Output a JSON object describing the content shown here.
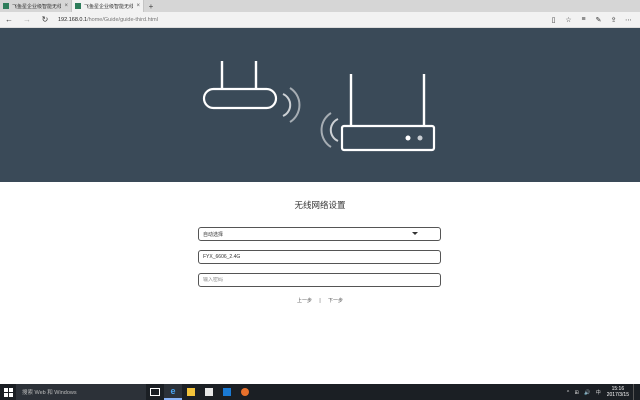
{
  "browser": {
    "tabs": [
      {
        "title": "飞鱼星企业级智能无线 | 转",
        "active": false
      },
      {
        "title": "飞鱼星企业级智能无线",
        "active": true
      }
    ],
    "new_tab_icon": "plus-icon",
    "url_host": "192.168.0.1",
    "url_path": "/home/Guide/guide-third.html",
    "nav_icons": [
      "back-icon",
      "forward-icon",
      "refresh-icon"
    ],
    "toolbar_icons": [
      "reading-view-icon",
      "favorite-star-icon",
      "hub-icon",
      "notes-icon",
      "share-icon",
      "more-icon"
    ]
  },
  "hero": {
    "background": "#3a4a58",
    "illustration": "router-wifi-icon"
  },
  "form": {
    "title": "无线网络设置",
    "mode_select": {
      "value": "自动选择"
    },
    "ssid_field": {
      "value": "FYX_6606_2.4G"
    },
    "password_field": {
      "placeholder": "输入密码"
    },
    "prev_link": "上一步",
    "separator": "|",
    "next_link": "下一步"
  },
  "taskbar": {
    "search_placeholder": "搜索 Web 和 Windows",
    "apps": [
      "task-view-icon",
      "edge-icon",
      "file-explorer-icon",
      "store-icon",
      "app-icon",
      "firefox-icon"
    ],
    "tray_text": "^ ⊞ 🔊 中",
    "time": "15:16",
    "date": "2017/3/15"
  }
}
